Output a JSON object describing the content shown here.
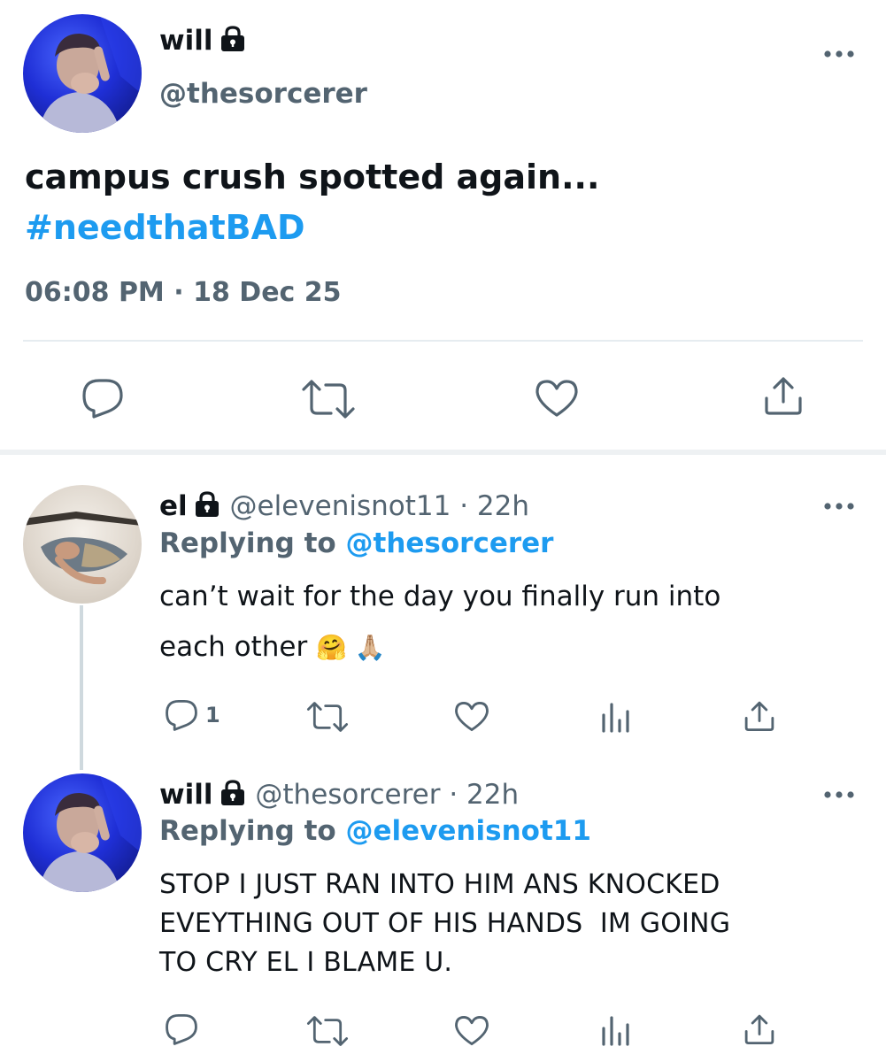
{
  "main_tweet": {
    "display_name": "will",
    "handle": "@thesorcerer",
    "text": "campus crush spotted again...",
    "hashtag": "#needthatBAD",
    "timestamp": "06:08 PM",
    "date": "18 Dec 25",
    "separator": "·"
  },
  "replies": [
    {
      "display_name": "el",
      "handle": "@elevenisnot11",
      "age": "22h",
      "replying_prefix": "Replying to",
      "replying_to": "@thesorcerer",
      "text_line1": "can’t wait for the day you finally run into",
      "text_line2": "each other",
      "emoji": "🤗 🙏🏼",
      "reply_count": "1"
    },
    {
      "display_name": "will",
      "handle": "@thesorcerer",
      "age": "22h",
      "replying_prefix": "Replying to",
      "replying_to": "@elevenisnot11",
      "text_line1": "STOP I JUST RAN INTO HIM ANS KNOCKED",
      "text_line2": "EVEYTHING OUT OF HIS HANDS  IM GOING",
      "text_line3": "TO CRY EL I BLAME U."
    }
  ],
  "icons": [
    "lock-icon",
    "more-icon",
    "reply-icon",
    "retweet-icon",
    "like-icon",
    "share-icon",
    "analytics-icon"
  ],
  "colors": {
    "link": "#1d9bf0",
    "secondary_text": "#536471",
    "primary_text": "#0f1419"
  }
}
